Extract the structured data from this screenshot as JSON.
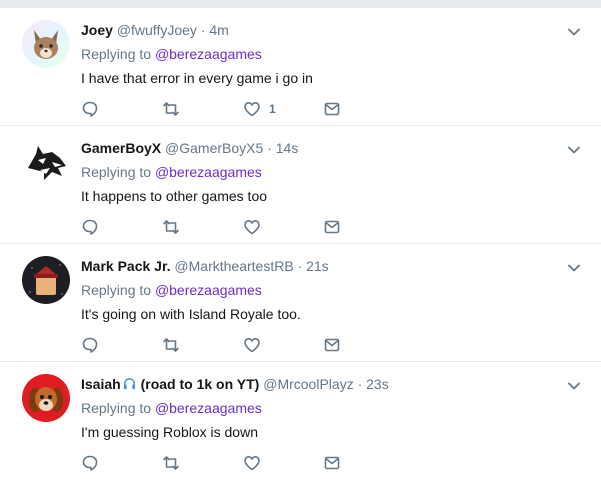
{
  "colors": {
    "accent": "#6e2fc6",
    "muted": "#657786",
    "text": "#14171a",
    "divider": "#e6ecf0"
  },
  "tweets": [
    {
      "name": "Joey",
      "handle": "@fwuffyJoey",
      "dot": "·",
      "time": "4m",
      "replying_prefix": "Replying to",
      "replying_to": "@berezaagames",
      "text": "I have that error in every game i go in",
      "like_count": "1",
      "avatar_icon": "fox-avatar-icon"
    },
    {
      "name": "GamerBoyX",
      "handle": "@GamerBoyX5",
      "dot": "·",
      "time": "14s",
      "replying_prefix": "Replying to",
      "replying_to": "@berezaagames",
      "text": "It happens to other games too",
      "like_count": "",
      "avatar_icon": "wolf-avatar-icon"
    },
    {
      "name": "Mark Pack Jr.",
      "handle": "@MarktheartestRB",
      "dot": "·",
      "time": "21s",
      "replying_prefix": "Replying to",
      "replying_to": "@berezaagames",
      "text": "It's going on with Island Royale too.",
      "like_count": "",
      "avatar_icon": "roblox-character-avatar-icon"
    },
    {
      "name": "Isaiah",
      "name_suffix": "(road to 1k on YT)",
      "handle": "@MrcoolPlayz",
      "dot": "·",
      "time": "23s",
      "replying_prefix": "Replying to",
      "replying_to": "@berezaagames",
      "text": "I'm guessing Roblox is down",
      "like_count": "",
      "avatar_icon": "dog-avatar-icon"
    }
  ]
}
